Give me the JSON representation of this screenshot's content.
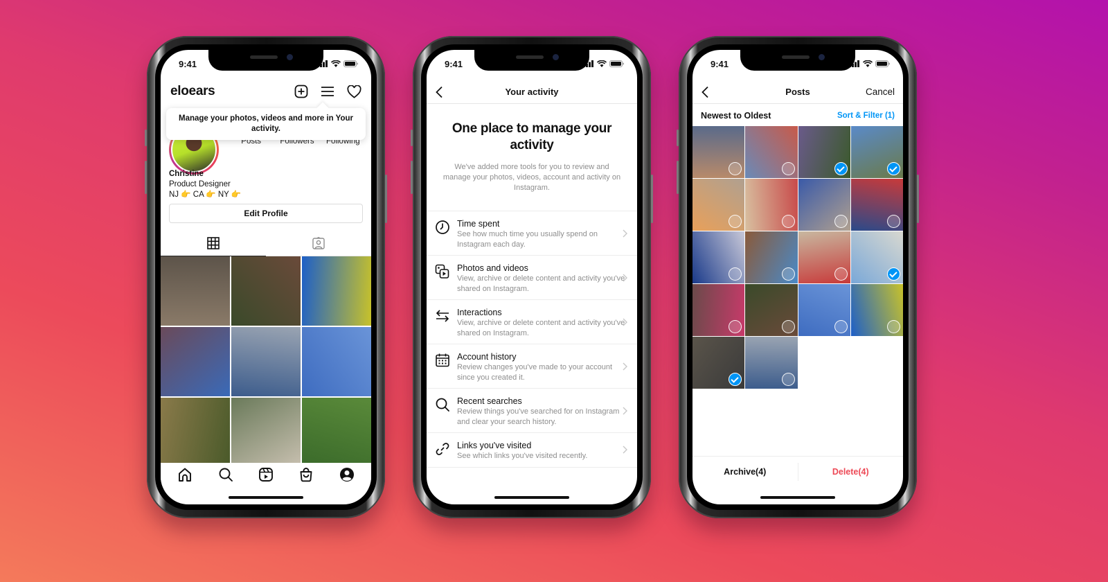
{
  "background": {
    "gradient_from": "#f47a5b",
    "gradient_mid": "#df3a6e",
    "gradient_to": "#b312ac"
  },
  "status_bar": {
    "time": "9:41"
  },
  "phone_profile": {
    "username": "eloears",
    "header_icons": [
      "new-post-icon",
      "menu-icon",
      "heart-icon"
    ],
    "tooltip": "Manage your photos, videos and more in Your activity.",
    "stats": {
      "posts_label": "Posts",
      "followers_label": "Followers",
      "following_label": "Following"
    },
    "bio": {
      "name": "Christine",
      "title": "Product Designer",
      "locations": "NJ 👉 CA 👉 NY 👉"
    },
    "edit_profile_label": "Edit Profile",
    "tabs": [
      {
        "icon": "grid-icon",
        "active": true
      },
      {
        "icon": "tagged-icon",
        "active": false
      }
    ],
    "grid_photos": [
      {
        "desc": "climbing wall holds",
        "colors": [
          "#8a7a68",
          "#5d544a"
        ]
      },
      {
        "desc": "woman profile with earring",
        "colors": [
          "#3a4a2a",
          "#6a4a3a"
        ]
      },
      {
        "desc": "yellow spiral structure sky",
        "colors": [
          "#1d5fc8",
          "#c8c22a"
        ]
      },
      {
        "desc": "two friends hugging",
        "colors": [
          "#6a4a5a",
          "#3a6ab8"
        ]
      },
      {
        "desc": "yellow balloons between buildings",
        "colors": [
          "#3c5c8c",
          "#9aa4b2"
        ]
      },
      {
        "desc": "ice cream cone sky",
        "colors": [
          "#3e6cc0",
          "#6a94d8"
        ]
      },
      {
        "desc": "tall grass",
        "colors": [
          "#8a7a4a",
          "#4a5a2a"
        ]
      },
      {
        "desc": "white dog",
        "colors": [
          "#6a7a5a",
          "#c8c0b0"
        ]
      },
      {
        "desc": "friends lying on grass",
        "colors": [
          "#3a6a2a",
          "#5a8a3a"
        ]
      }
    ],
    "bottom_nav": [
      "home-icon",
      "search-icon",
      "reels-icon",
      "shop-icon",
      "profile-icon"
    ]
  },
  "phone_activity": {
    "nav_title": "Your activity",
    "hero_title": "One place to manage your activity",
    "hero_desc": "We've added more tools for you to review and manage your photos, videos, account and activity on Instagram.",
    "items": [
      {
        "icon": "clock-icon",
        "title": "Time spent",
        "desc": "See how much time you usually spend on Instagram each day."
      },
      {
        "icon": "photos-videos-icon",
        "title": "Photos and videos",
        "desc": "View, archive or delete content and activity you've shared on Instagram."
      },
      {
        "icon": "interactions-icon",
        "title": "Interactions",
        "desc": "View, archive or delete content and activity you've shared on Instagram."
      },
      {
        "icon": "calendar-icon",
        "title": "Account history",
        "desc": "Review changes you've made to your account since you created it."
      },
      {
        "icon": "search-icon",
        "title": "Recent searches",
        "desc": "Review things you've searched for on Instagram and clear your search history."
      },
      {
        "icon": "link-icon",
        "title": "Links you've visited",
        "desc": "See which links you've visited recently."
      }
    ]
  },
  "phone_posts": {
    "nav_title": "Posts",
    "cancel_label": "Cancel",
    "sort_label": "Newest to Oldest",
    "sort_filter_label": "Sort & Filter (1)",
    "accent_color": "#0095f6",
    "delete_color": "#ed4956",
    "photos": [
      {
        "desc": "selfie woman",
        "selected": false,
        "colors": [
          "#b88a6a",
          "#5a6a8a"
        ]
      },
      {
        "desc": "friends jumping",
        "selected": false,
        "colors": [
          "#6a8ab8",
          "#c85a4a"
        ]
      },
      {
        "desc": "purple flowers",
        "selected": true,
        "colors": [
          "#6a5a8a",
          "#3a5a2a"
        ]
      },
      {
        "desc": "statue on hill",
        "selected": true,
        "colors": [
          "#5a8ac8",
          "#6a7a4a"
        ]
      },
      {
        "desc": "striped umbrella",
        "selected": false,
        "colors": [
          "#e8a05a",
          "#b0a090"
        ]
      },
      {
        "desc": "man dancing",
        "selected": false,
        "colors": [
          "#d8c0a0",
          "#c84a4a"
        ]
      },
      {
        "desc": "woman hands on head",
        "selected": false,
        "colors": [
          "#3a5aa8",
          "#b0a090"
        ]
      },
      {
        "desc": "four friends sitting",
        "selected": false,
        "colors": [
          "#2a4a8a",
          "#c83a3a"
        ]
      },
      {
        "desc": "woman by statue",
        "selected": false,
        "colors": [
          "#1a3a8a",
          "#c8c8d8"
        ]
      },
      {
        "desc": "ball on head",
        "selected": false,
        "colors": [
          "#8a5a3a",
          "#4a8ac8"
        ]
      },
      {
        "desc": "smiling woman",
        "selected": false,
        "colors": [
          "#c8b8a0",
          "#c83a3a"
        ]
      },
      {
        "desc": "man lying on wall",
        "selected": true,
        "colors": [
          "#7aa8d8",
          "#d8d8d0"
        ]
      },
      {
        "desc": "two friends hugging",
        "selected": false,
        "colors": [
          "#6a4a4a",
          "#c83a6a"
        ]
      },
      {
        "desc": "woman profile earring",
        "selected": false,
        "colors": [
          "#3a4a2a",
          "#6a4a3a"
        ]
      },
      {
        "desc": "ice cream sky",
        "selected": false,
        "colors": [
          "#3e6cc0",
          "#6a94d8"
        ]
      },
      {
        "desc": "yellow spiral",
        "selected": false,
        "colors": [
          "#1d5fc8",
          "#c8c22a"
        ]
      },
      {
        "desc": "climbing wall",
        "selected": true,
        "colors": [
          "#5a544a",
          "#3a3a3a"
        ]
      },
      {
        "desc": "balloons between buildings",
        "selected": false,
        "colors": [
          "#3c5c8c",
          "#9aa4b2"
        ]
      }
    ],
    "archive_label": "Archive(4)",
    "delete_label": "Delete(4)"
  }
}
